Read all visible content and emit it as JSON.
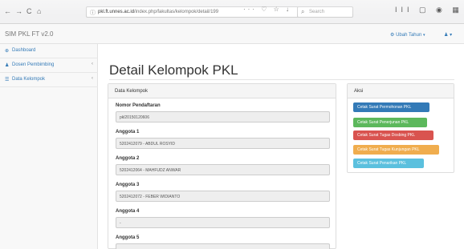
{
  "browser": {
    "back_icon": "←",
    "forward_icon": "→",
    "reload_icon": "C",
    "home_icon": "⌂",
    "info_icon": "ⓘ",
    "url_host": "pkl.ft.unnes.ac.id",
    "url_path": "/index.php/fakultas/kelompok/detail/199",
    "url_tools": "··· ♡ ☆ ↓",
    "search_placeholder": "Search",
    "right_tools": "III ▢ ◉ ▦ ≡"
  },
  "app": {
    "brand": "SIM PKL FT v2.0",
    "user_menu_label": "Ubah Tahun",
    "user_menu_icon": "⚙",
    "caret": "▾",
    "user_icon": "♟"
  },
  "sidebar": {
    "items": [
      {
        "label": "Dashboard",
        "icon": "⊕",
        "has_arrow": false
      },
      {
        "label": "Dosen Pembimbing",
        "icon": "♟",
        "has_arrow": true
      },
      {
        "label": "Data Kelompok",
        "icon": "☰",
        "has_arrow": true
      }
    ],
    "arrow": "‹"
  },
  "main": {
    "title": "Detail Kelompok PKL",
    "data_panel": {
      "title": "Data Kelompok",
      "fields": [
        {
          "label": "Nomor Pendaftaran",
          "value": "pkl20150120606"
        },
        {
          "label": "Anggota 1",
          "value": "5202412079 - ABDUL ROSYID"
        },
        {
          "label": "Anggota 2",
          "value": "5202412064 - MAHFUDZ ANWAR"
        },
        {
          "label": "Anggota 3",
          "value": "5202412072 - FEBER WIDIANTO"
        },
        {
          "label": "Anggota 4",
          "value": "-"
        },
        {
          "label": "Anggota 5",
          "value": ""
        }
      ]
    },
    "aksi_panel": {
      "title": "Aksi",
      "buttons": [
        {
          "label": "Cetak Surat Permohonan PKL",
          "color": "#337ab7"
        },
        {
          "label": "Cetak Surat Penerjunan PKL",
          "color": "#5cb85c"
        },
        {
          "label": "Cetak Surat Tugas Dosbing PKL",
          "color": "#d9534f"
        },
        {
          "label": "Cetak Surat Tugas Kunjungan PKL",
          "color": "#f0ad4e"
        },
        {
          "label": "Cetak Surat Penarikan PKL",
          "color": "#5bc0de"
        }
      ]
    }
  }
}
